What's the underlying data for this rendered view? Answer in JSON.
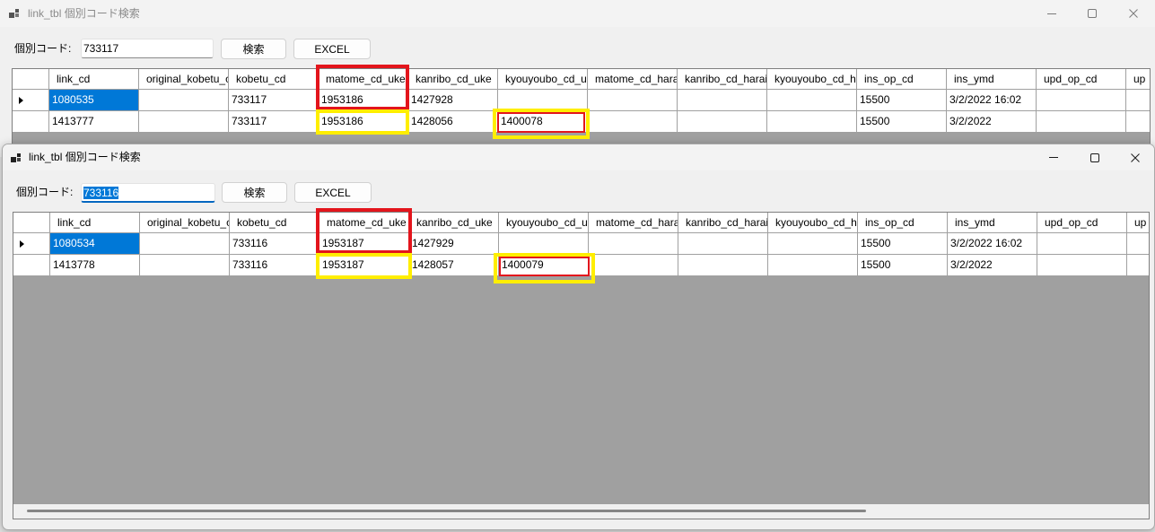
{
  "icons": {
    "app": "app-window-icon",
    "minimize": "minimize-icon",
    "maximize": "maximize-icon",
    "close": "close-icon",
    "current_row": "current-row-indicator-icon"
  },
  "colors": {
    "selection": "#0078d7",
    "focus_underline": "#0067c0",
    "grid_background": "#a0a0a0",
    "highlight_red": "#e3151c",
    "highlight_yellow": "#ffee00"
  },
  "columns": [
    "link_cd",
    "original_kobetu_c",
    "kobetu_cd",
    "matome_cd_uke",
    "kanribo_cd_uke",
    "kyouyoubo_cd_u",
    "matome_cd_hara",
    "kanribo_cd_harai",
    "kyouyoubo_cd_h",
    "ins_op_cd",
    "ins_ymd",
    "upd_op_cd",
    "up"
  ],
  "windows": {
    "back": {
      "title": "link_tbl 個別コード検索",
      "search_label": "個別コード:",
      "search_value": "733117",
      "search_button": "検索",
      "excel_button": "EXCEL",
      "selected_cell": {
        "row": 0,
        "column": 0
      },
      "rows": [
        [
          "1080535",
          "",
          "733117",
          "1953186",
          "1427928",
          "",
          "",
          "",
          "",
          "15500",
          "3/2/2022 16:02",
          "",
          ""
        ],
        [
          "1413777",
          "",
          "733117",
          "1953186",
          "1428056",
          "1400078",
          "",
          "",
          "",
          "15500",
          "3/2/2022",
          "",
          ""
        ]
      ]
    },
    "front": {
      "title": "link_tbl 個別コード検索",
      "search_label": "個別コード:",
      "search_value": "733116",
      "search_button": "検索",
      "excel_button": "EXCEL",
      "selected_cell": {
        "row": 0,
        "column": 0
      },
      "rows": [
        [
          "1080534",
          "",
          "733116",
          "1953187",
          "1427929",
          "",
          "",
          "",
          "",
          "15500",
          "3/2/2022 16:02",
          "",
          ""
        ],
        [
          "1413778",
          "",
          "733116",
          "1953187",
          "1428057",
          "1400079",
          "",
          "",
          "",
          "15500",
          "3/2/2022",
          "",
          ""
        ]
      ]
    }
  }
}
